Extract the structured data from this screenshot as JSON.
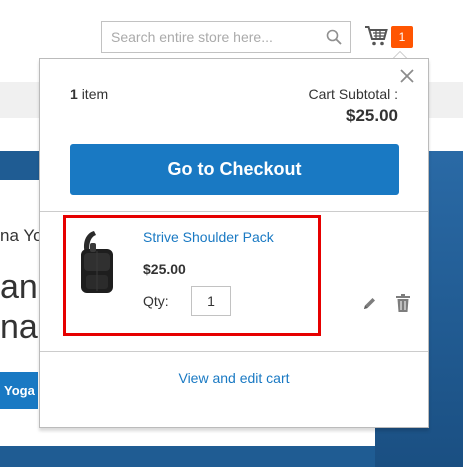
{
  "header": {
    "search_placeholder": "Search entire store here...",
    "cart_count": "1"
  },
  "background": {
    "hero_small_text": "na Yo",
    "hero_big_line1": "an",
    "hero_big_line2": "nal",
    "hero_button": "Yoga"
  },
  "minicart": {
    "items_count": "1",
    "items_label": "item",
    "subtotal_label": "Cart Subtotal :",
    "subtotal_amount": "$25.00",
    "checkout_label": "Go to Checkout",
    "item": {
      "name": "Strive Shoulder Pack",
      "price": "$25.00",
      "qty_label": "Qty:",
      "qty_value": "1"
    },
    "view_cart_label": "View and edit cart"
  },
  "colors": {
    "primary": "#1979c3",
    "badge": "#ff5501",
    "highlight": "#e60000"
  },
  "icons": [
    "search-icon",
    "cart-icon",
    "close-icon",
    "edit-pencil-icon",
    "trash-icon"
  ]
}
